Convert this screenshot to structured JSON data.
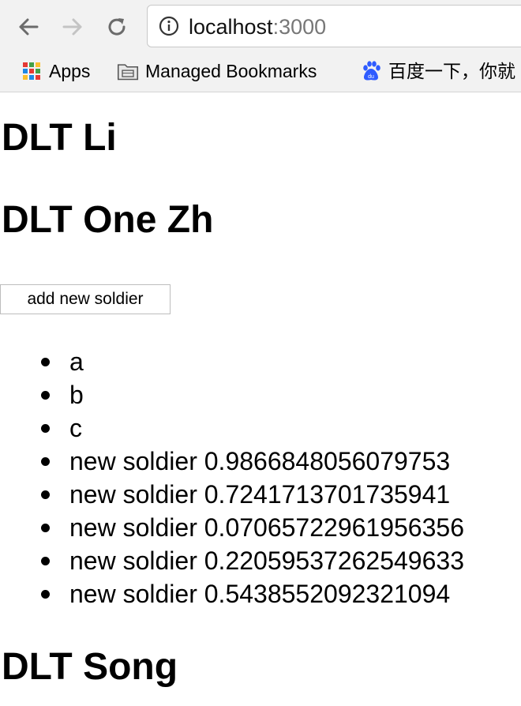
{
  "browser": {
    "url_host": "localhost",
    "url_port": ":3000",
    "bookmarks": [
      {
        "label": "Apps",
        "icon": "apps-grid-icon"
      },
      {
        "label": "Managed Bookmarks",
        "icon": "folder-icon"
      },
      {
        "label": "百度一下，你就",
        "icon": "baidu-icon"
      }
    ]
  },
  "page": {
    "heading_1": "DLT Li",
    "heading_2": "DLT One Zh",
    "add_button_label": "add new soldier",
    "soldiers": [
      "a",
      "b",
      "c",
      "new soldier 0.9866848056079753",
      "new soldier 0.7241713701735941",
      "new soldier 0.07065722961956356",
      "new soldier 0.22059537262549633",
      "new soldier 0.5438552092321094"
    ],
    "heading_3": "DLT Song"
  }
}
